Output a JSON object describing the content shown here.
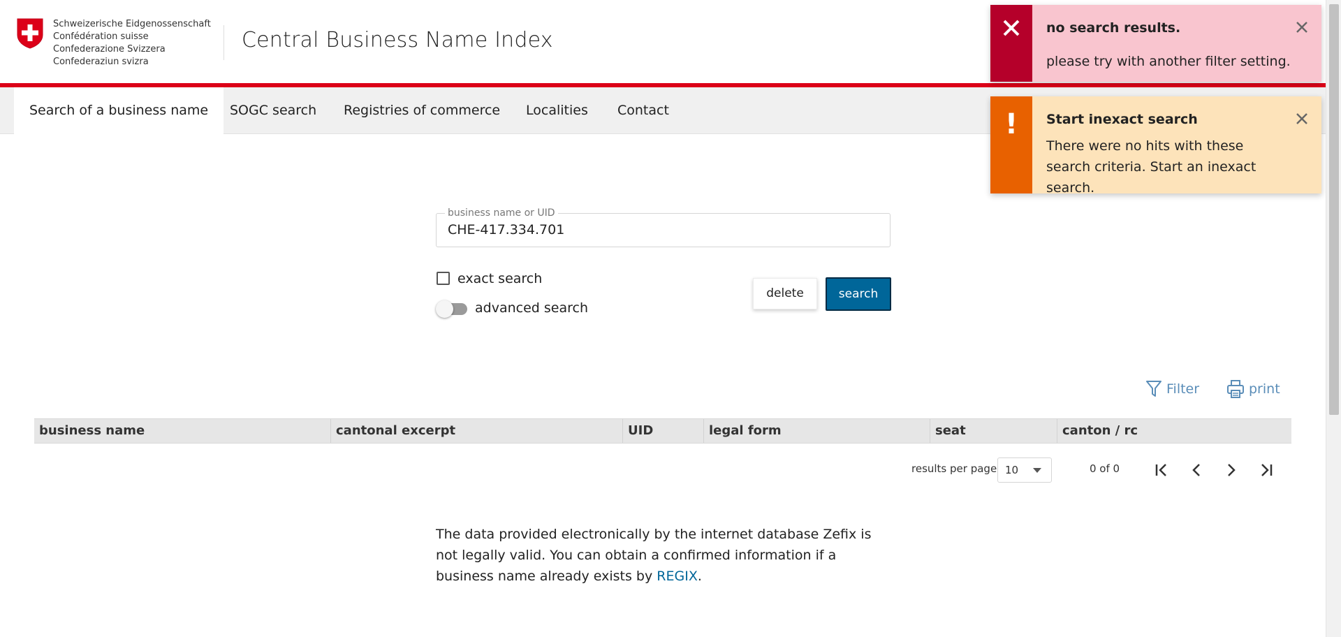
{
  "header": {
    "confederation": [
      "Schweizerische Eidgenossenschaft",
      "Confédération suisse",
      "Confederazione Svizzera",
      "Confederaziun svizra"
    ],
    "app_title": "Central Business Name Index",
    "brand_red": "#dc0018"
  },
  "nav": {
    "tabs": [
      {
        "label": "Search of a business name",
        "active": true
      },
      {
        "label": "SOGC search",
        "active": false
      },
      {
        "label": "Registries of commerce",
        "active": false
      },
      {
        "label": "Localities",
        "active": false
      },
      {
        "label": "Contact",
        "active": false
      }
    ]
  },
  "search": {
    "field_label": "business name or UID",
    "value": "CHE-417.334.701",
    "exact_search_label": "exact search",
    "exact_search_checked": false,
    "advanced_search_label": "advanced search",
    "advanced_search_on": false,
    "delete_label": "delete",
    "search_label": "search",
    "accent": "#006699"
  },
  "tools": {
    "filter_label": "Filter",
    "filter_icon": "funnel-icon",
    "print_label": "print",
    "print_icon": "printer-icon"
  },
  "table": {
    "columns": [
      "business name",
      "cantonal excerpt",
      "UID",
      "legal form",
      "seat",
      "canton / rc"
    ],
    "rows": []
  },
  "paginator": {
    "results_per_page_label": "results per page",
    "results_per_page_value": "10",
    "range_label": "0 of 0"
  },
  "disclaimer": {
    "text": "The data provided electronically by the internet database Zefix is not legally valid. You can obtain a confirmed information if a business name already exists by ",
    "link": "REGIX",
    "end": "."
  },
  "toasts": {
    "error": {
      "title": "no search results.",
      "message": "please try with another filter setting.",
      "color": "#b5002a",
      "icon": "x-icon"
    },
    "warning": {
      "title": "Start inexact search",
      "message": "There were no hits with these search criteria. Start an inexact search.",
      "color": "#e86100",
      "icon": "exclamation-icon"
    }
  }
}
